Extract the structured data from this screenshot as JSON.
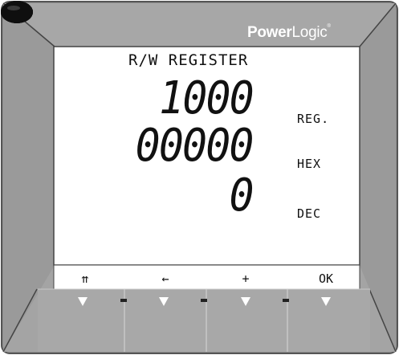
{
  "device": {
    "brand_bold": "Power",
    "brand_light": "Logic",
    "brand_mark": "®"
  },
  "screen": {
    "title": "R/W REGISTER",
    "register_value": "1000",
    "register_unit": "REG.",
    "hex_value": "00000",
    "hex_unit": "HEX",
    "dec_value": "0",
    "dec_unit": "DEC"
  },
  "softkeys": [
    {
      "label": "⇈",
      "icon": "up-level-icon"
    },
    {
      "label": "←",
      "icon": "left-arrow-icon"
    },
    {
      "label": "+",
      "icon": "plus-icon"
    },
    {
      "label": "OK",
      "icon": "ok"
    }
  ],
  "colors": {
    "bezel": "#8c8c8c",
    "bezel_light": "#bdbdbd",
    "lcd": "#ffffff",
    "button": "#0f0f0f"
  }
}
